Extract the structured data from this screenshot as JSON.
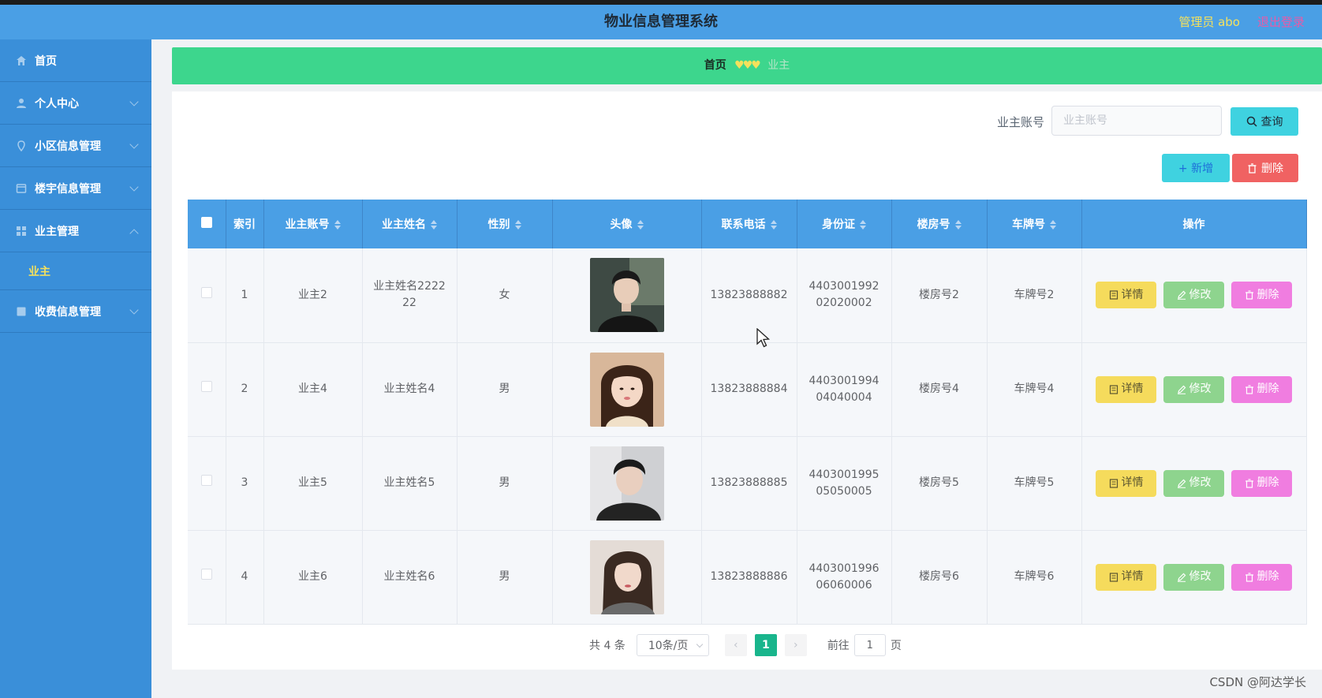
{
  "header": {
    "title": "物业信息管理系统",
    "admin_label": "管理员 abo",
    "logout_label": "退出登录"
  },
  "sidebar": {
    "items": [
      {
        "label": "首页",
        "icon": "home-icon"
      },
      {
        "label": "个人中心",
        "icon": "user-icon"
      },
      {
        "label": "小区信息管理",
        "icon": "location-icon"
      },
      {
        "label": "楼宇信息管理",
        "icon": "building-icon"
      },
      {
        "label": "业主管理",
        "icon": "grid-icon"
      },
      {
        "label": "收费信息管理",
        "icon": "fee-icon"
      }
    ],
    "submenu_label": "业主"
  },
  "breadcrumb": {
    "home": "首页",
    "separator": "♥♥♥",
    "current": "业主"
  },
  "search": {
    "label": "业主账号",
    "placeholder": "业主账号",
    "query_button": "查询"
  },
  "actions": {
    "add_button": "+ 新增",
    "delete_button": "删除"
  },
  "table": {
    "headers": [
      "索引",
      "业主账号",
      "业主姓名",
      "性别",
      "头像",
      "联系电话",
      "身份证",
      "楼房号",
      "车牌号",
      "操作"
    ],
    "rows": [
      {
        "index": "1",
        "account": "业主2",
        "name": "业主姓名222222",
        "gender": "女",
        "phone": "13823888882",
        "id_card": "440300199202020002",
        "building": "楼房号2",
        "plate": "车牌号2"
      },
      {
        "index": "2",
        "account": "业主4",
        "name": "业主姓名4",
        "gender": "男",
        "phone": "13823888884",
        "id_card": "440300199404040004",
        "building": "楼房号4",
        "plate": "车牌号4"
      },
      {
        "index": "3",
        "account": "业主5",
        "name": "业主姓名5",
        "gender": "男",
        "phone": "13823888885",
        "id_card": "440300199505050005",
        "building": "楼房号5",
        "plate": "车牌号5"
      },
      {
        "index": "4",
        "account": "业主6",
        "name": "业主姓名6",
        "gender": "男",
        "phone": "13823888886",
        "id_card": "440300199606060006",
        "building": "楼房号6",
        "plate": "车牌号6"
      }
    ],
    "op_labels": {
      "detail": "详情",
      "edit": "修改",
      "remove": "删除"
    }
  },
  "pagination": {
    "total": "共 4 条",
    "page_size": "10条/页",
    "current_page": "1",
    "goto_label": "前往",
    "goto_value": "1",
    "page_suffix": "页"
  },
  "watermark": "CSDN @阿达学长",
  "colors": {
    "header_bg": "#4a9fe5",
    "sidebar_bg": "#3a8fd9",
    "breadcrumb_bg": "#3dd68d",
    "accent_cyan": "#3fd2e0",
    "danger": "#f06262",
    "detail": "#f5db5c",
    "edit": "#8ed48e",
    "remove": "#f07de0"
  }
}
